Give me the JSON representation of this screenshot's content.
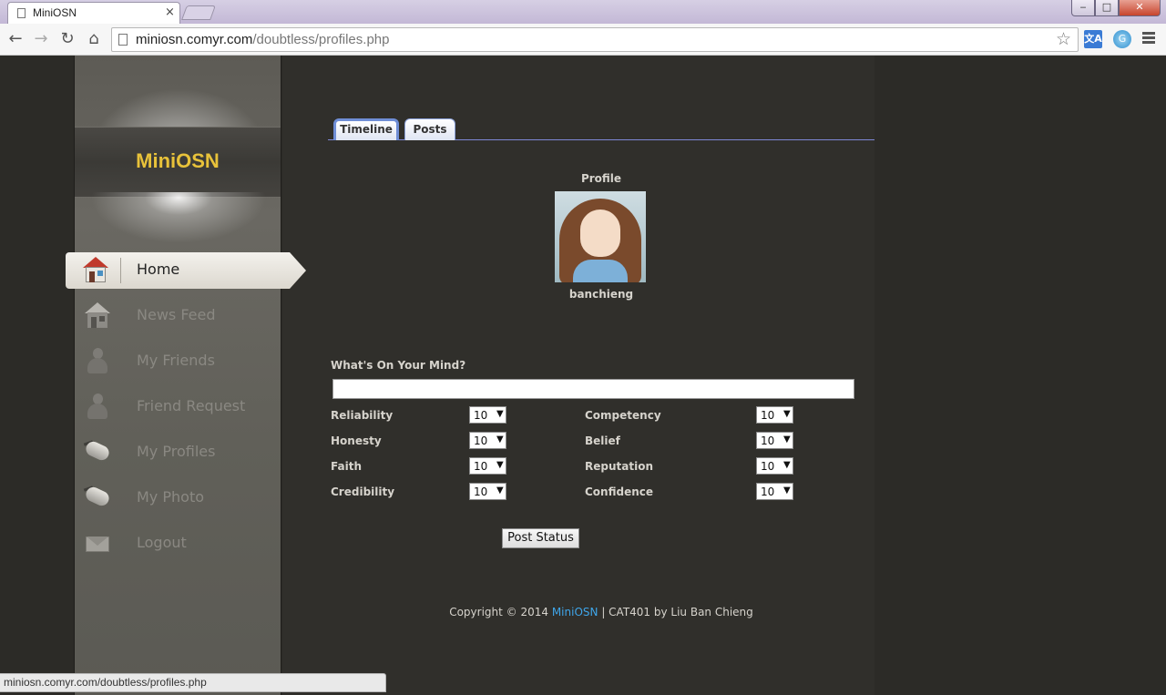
{
  "browser": {
    "tab_title": "MiniOSN",
    "tab_close": "×",
    "url_host": "miniosn.comyr.com",
    "url_path": "/doubtless/profiles.php",
    "window_controls": {
      "minimize": "‒",
      "maximize": "□",
      "close": "✕"
    },
    "status_url": "miniosn.comyr.com/doubtless/profiles.php"
  },
  "sidebar": {
    "logo": "MiniOSN",
    "items": [
      {
        "label": "Home",
        "icon": "home-icon",
        "active": true
      },
      {
        "label": "News Feed",
        "icon": "news-house-icon"
      },
      {
        "label": "My Friends",
        "icon": "person-icon"
      },
      {
        "label": "Friend Request",
        "icon": "person-icon"
      },
      {
        "label": "My Profiles",
        "icon": "mouse-icon"
      },
      {
        "label": "My Photo",
        "icon": "mouse-icon"
      },
      {
        "label": "Logout",
        "icon": "envelope-icon"
      }
    ]
  },
  "tabs": [
    {
      "label": "Timeline",
      "active": true
    },
    {
      "label": "Posts",
      "active": false
    }
  ],
  "profile": {
    "label": "Profile",
    "username": "banchieng"
  },
  "status_form": {
    "label": "What's On Your Mind?",
    "value": "",
    "attributes_left": [
      {
        "label": "Reliability",
        "value": "10"
      },
      {
        "label": "Honesty",
        "value": "10"
      },
      {
        "label": "Faith",
        "value": "10"
      },
      {
        "label": "Credibility",
        "value": "10"
      }
    ],
    "attributes_right": [
      {
        "label": "Competency",
        "value": "10"
      },
      {
        "label": "Belief",
        "value": "10"
      },
      {
        "label": "Reputation",
        "value": "10"
      },
      {
        "label": "Confidence",
        "value": "10"
      }
    ],
    "submit_label": "Post Status"
  },
  "footer": {
    "prefix": "Copyright © 2014 ",
    "link": "MiniOSN",
    "suffix": " | CAT401 by Liu Ban Chieng"
  },
  "colors": {
    "logo": "#e8c23a",
    "link": "#3fa6ea",
    "page_bg": "#2c2b27",
    "tab_border": "#7d87d6"
  }
}
